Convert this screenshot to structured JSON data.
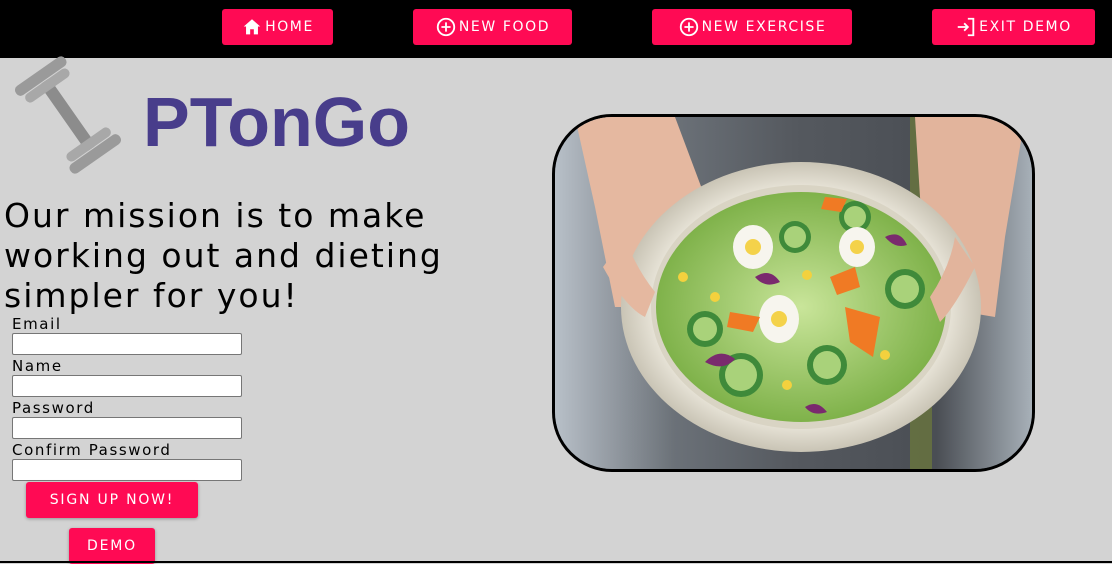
{
  "nav": {
    "items": [
      {
        "label": "HOME",
        "icon": "home-icon"
      },
      {
        "label": "NEW FOOD",
        "icon": "add-circle-icon"
      },
      {
        "label": "NEW EXERCISE",
        "icon": "add-circle-icon"
      },
      {
        "label": "EXIT DEMO",
        "icon": "exit-icon"
      }
    ]
  },
  "brand": {
    "name": "PTonGo",
    "logo_icon": "dumbbell-icon"
  },
  "mission": "Our mission is to make working out and dieting simpler for you!",
  "form": {
    "email_label": "Email",
    "email_value": "",
    "name_label": "Name",
    "name_value": "",
    "password_label": "Password",
    "password_value": "",
    "confirm_label": "Confirm Password",
    "confirm_value": "",
    "signup_label": "SIGN UP NOW!",
    "demo_label": "DEMO"
  },
  "hero_image": {
    "subject": "salad-bowl-photo"
  },
  "colors": {
    "accent": "#ff0a54",
    "brand": "#483d8b",
    "background": "#d3d3d3",
    "navbar": "#000000"
  }
}
